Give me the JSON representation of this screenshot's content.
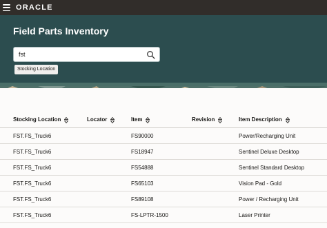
{
  "app": {
    "logo_text": "ORACLE",
    "title": "Field Parts Inventory"
  },
  "colors": {
    "topbar": "#312d2a",
    "header": "#2c4d4f",
    "page": "#fcfbfa"
  },
  "search": {
    "value": "fst",
    "icon": "search-icon"
  },
  "filter_chip": "Stocking Location",
  "table": {
    "columns": [
      "Stocking Location",
      "Locator",
      "Item",
      "Revision",
      "Item Description"
    ],
    "rows": [
      [
        "FST.FS_Truck6",
        "",
        "FS90000",
        "",
        "Power/Recharging Unit"
      ],
      [
        "FST.FS_Truck6",
        "",
        "FS18947",
        "",
        "Sentinel Deluxe Desktop"
      ],
      [
        "FST.FS_Truck6",
        "",
        "FS54888",
        "",
        "Sentinel Standard Desktop"
      ],
      [
        "FST.FS_Truck6",
        "",
        "FS65103",
        "",
        "Vision Pad - Gold"
      ],
      [
        "FST.FS_Truck6",
        "",
        "FS89108",
        "",
        "Power / Recharging Unit"
      ],
      [
        "FST.FS_Truck6",
        "",
        "FS-LPTR-1500",
        "",
        "Laser Printer"
      ]
    ]
  }
}
